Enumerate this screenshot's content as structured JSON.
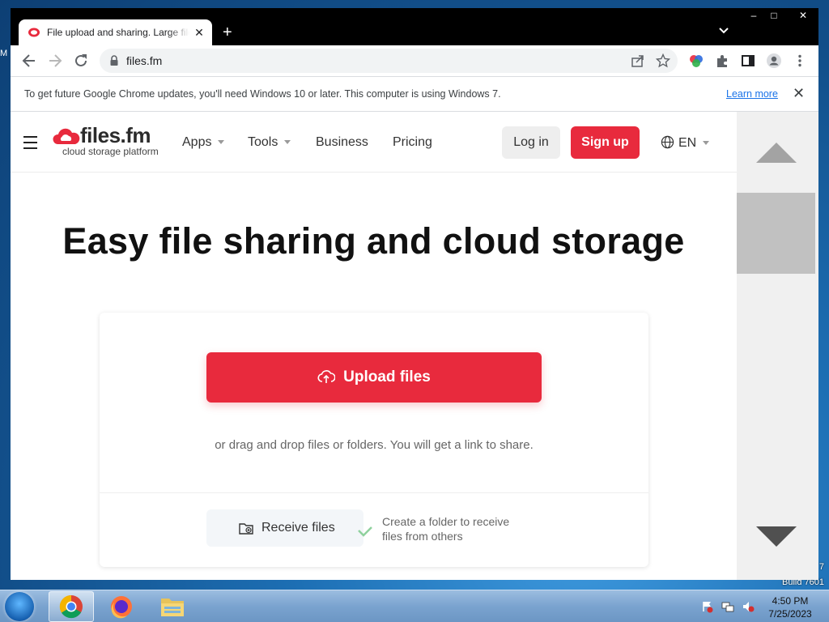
{
  "desktop": {
    "corner_text": "7",
    "build_text": "Build 7601",
    "left_edge_text": "M"
  },
  "browser": {
    "tab_title": "File upload and sharing. Large files",
    "address": "files.fm",
    "infobar_text": "To get future Google Chrome updates, you'll need Windows 10 or later. This computer is using Windows 7.",
    "infobar_link": "Learn more",
    "win_min": "–",
    "win_max": "□",
    "win_close": "✕",
    "tab_close": "✕",
    "new_tab": "+",
    "infobar_close": "✕"
  },
  "site": {
    "logo_text": "files.fm",
    "logo_sub": "cloud storage platform",
    "nav": {
      "apps": "Apps",
      "tools": "Tools",
      "business": "Business",
      "pricing": "Pricing"
    },
    "login": "Log in",
    "signup": "Sign up",
    "lang": "EN",
    "hero_title": "Easy file sharing and cloud storage",
    "upload_button": "Upload files",
    "drag_hint": "or drag and drop files or folders. You will get a link to share.",
    "receive_button": "Receive files",
    "receive_hint": "Create a folder to receive files from others"
  },
  "taskbar": {
    "time": "4:50 PM",
    "date": "7/25/2023"
  },
  "colors": {
    "brand_red": "#e82a3d",
    "link_blue": "#1a73e8"
  },
  "icons": [
    "back-icon",
    "forward-icon",
    "reload-icon",
    "lock-icon",
    "share-icon",
    "star-icon",
    "extension-icon",
    "sidepanel-icon",
    "profile-icon",
    "menu-icon",
    "globe-icon",
    "upload-cloud-icon",
    "folder-plus-icon",
    "check-icon"
  ]
}
